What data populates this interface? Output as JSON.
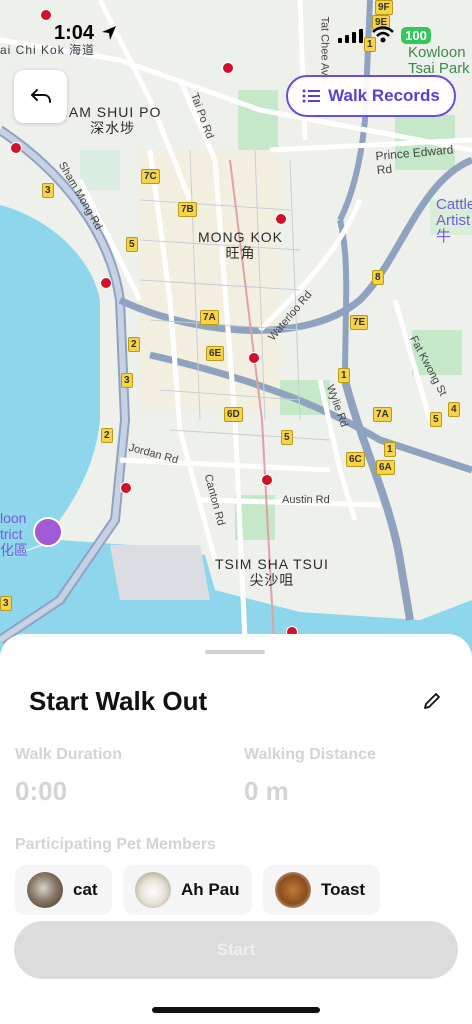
{
  "status_bar": {
    "time": "1:04",
    "battery": "100"
  },
  "header": {
    "back_icon": "back-arrow-icon",
    "records_label": "Walk Records",
    "records_icon": "list-icon",
    "accent": "#5b3fd6"
  },
  "map": {
    "districts": {
      "sham_shui_po_en": "IAM SHUI PO",
      "sham_shui_po_zh": "深水埗",
      "mong_kok_en": "MONG KOK",
      "mong_kok_zh": "旺角",
      "tst_en": "TSIM SHA TSUI",
      "tst_zh": "尖沙咀",
      "kowloon_tsai_en1": "Kowloon",
      "kowloon_tsai_en2": "Tsai Park",
      "cattle_en1": "Cattle",
      "cattle_en2": "Artist",
      "cattle_zh": "牛",
      "west_kowloon_en1": "loon",
      "west_kowloon_en2": "trict",
      "west_kowloon_zh": "化區",
      "top_left_zh": "ai Chi Kok 海道"
    },
    "roads": {
      "tai_po": "Tai Po Rd",
      "sham_mong": "Sham Mong Rd",
      "prince_edward": "Prince Edward Rd",
      "waterloo": "Waterloo Rd",
      "tat_chee": "Tat Chee Av",
      "fat_kwong": "Fat Kwong St",
      "wylie": "Wylie Rd",
      "jordan": "Jordan Rd",
      "canton": "Canton Rd",
      "austin": "Austin Rd"
    },
    "shields": [
      "9F",
      "9E",
      "1",
      "3",
      "7C",
      "7B",
      "5",
      "2",
      "3",
      "2",
      "7A",
      "6E",
      "6D",
      "5",
      "8",
      "7E",
      "1",
      "7A",
      "6C",
      "1",
      "6A",
      "5",
      "4",
      "3"
    ]
  },
  "sheet": {
    "title": "Start Walk Out",
    "edit_icon": "pencil-icon",
    "duration_label": "Walk Duration",
    "duration_value": "0:00",
    "distance_label": "Walking Distance",
    "distance_value": "0 m",
    "members_label": "Participating Pet Members",
    "pets": [
      {
        "name": "cat"
      },
      {
        "name": "Ah Pau"
      },
      {
        "name": "Toast"
      }
    ],
    "start_label": "Start"
  }
}
